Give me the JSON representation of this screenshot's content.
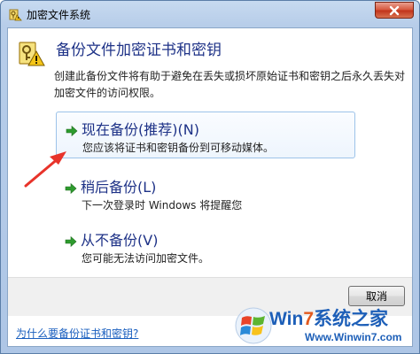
{
  "window": {
    "title": "加密文件系统"
  },
  "header": {
    "title": "备份文件加密证书和密钥",
    "description": "创建此备份文件将有助于避免在丢失或损坏原始证书和密钥之后永久丢失对加密文件的访问权限。"
  },
  "options": [
    {
      "title": "现在备份(推荐)(N)",
      "subtitle": "您应该将证书和密钥备份到可移动媒体。",
      "selected": true
    },
    {
      "title": "稍后备份(L)",
      "subtitle": "下一次登录时 Windows 将提醒您",
      "selected": false
    },
    {
      "title": "从不备份(V)",
      "subtitle": "您可能无法访问加密文件。",
      "selected": false
    }
  ],
  "footer": {
    "cancel_label": "取消",
    "help_link": "为什么要备份证书和密钥?"
  },
  "watermark": {
    "brand_prefix": "Win",
    "brand_seven": "7",
    "brand_suffix": "系统之家",
    "url": "Www.Winwin7.com"
  },
  "colors": {
    "heading_blue": "#1e3287",
    "link_blue": "#1a5fbf",
    "pointer_red": "#e8332a",
    "arrow_green": "#2e9b2e"
  }
}
